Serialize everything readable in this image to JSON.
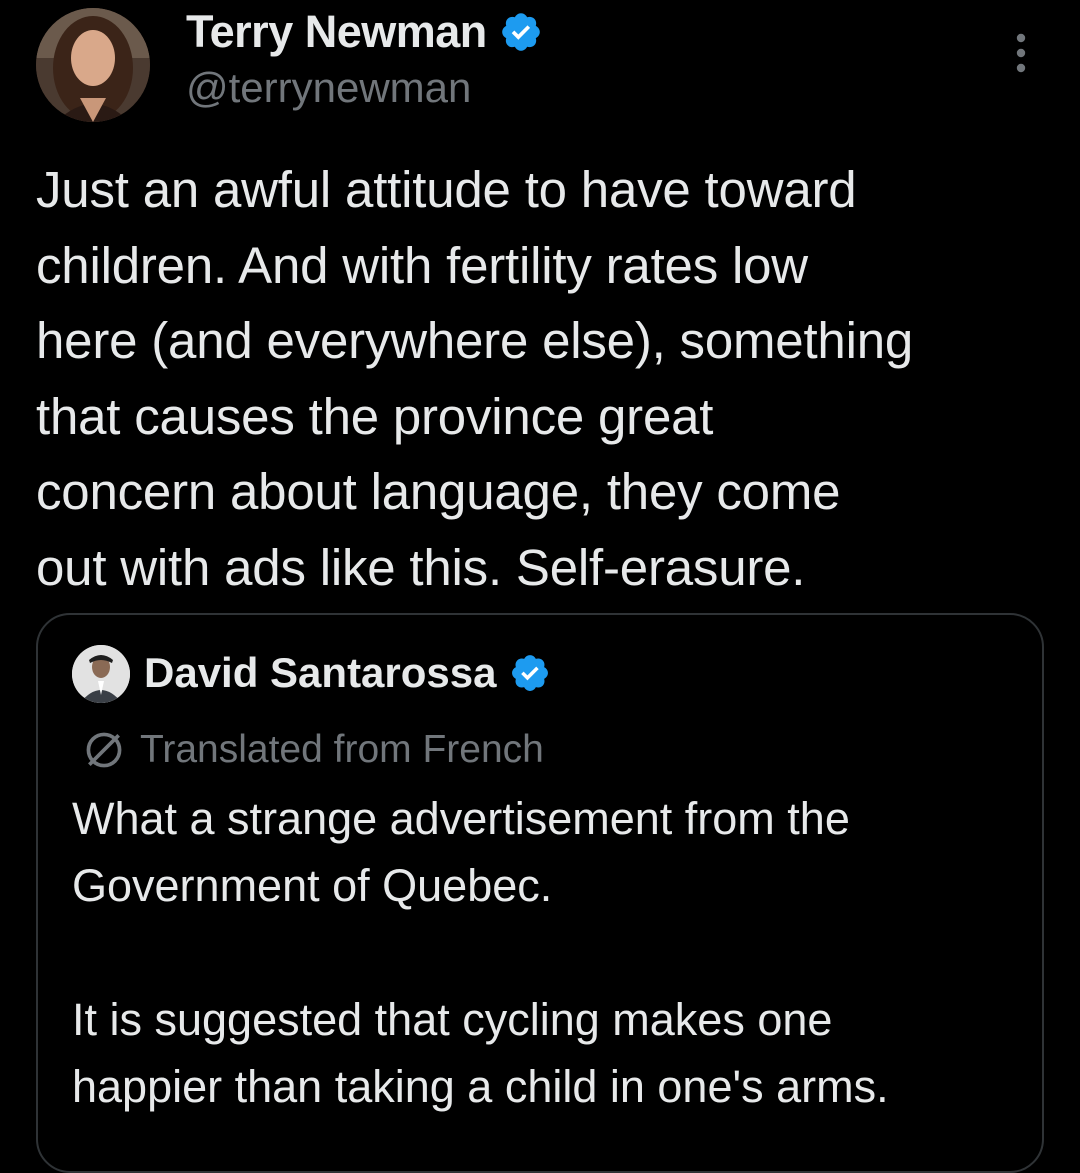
{
  "tweet": {
    "author": {
      "display_name": "Terry Newman",
      "handle": "@terrynewman",
      "verified": true
    },
    "text": "Just an awful attitude to have toward\nchildren. And with fertility rates low\nhere (and everywhere else), something\nthat causes the province great\nconcern about language, they come\nout with ads like this. Self-erasure."
  },
  "quote": {
    "author": {
      "display_name": "David Santarossa",
      "verified": true
    },
    "translation_label": "Translated from French",
    "text": "What a strange advertisement from the\nGovernment of Quebec.\n\nIt is suggested that cycling makes one\nhappier than taking a child in one's arms."
  },
  "colors": {
    "background": "#000000",
    "primary_text": "#e7e9ea",
    "secondary_text": "#71767b",
    "verified_badge": "#1d9bf0",
    "card_border": "#2f3336"
  },
  "icons": {
    "verified": "verified-badge-icon",
    "more": "more-vertical-icon",
    "translate": "translate-globe-icon"
  }
}
